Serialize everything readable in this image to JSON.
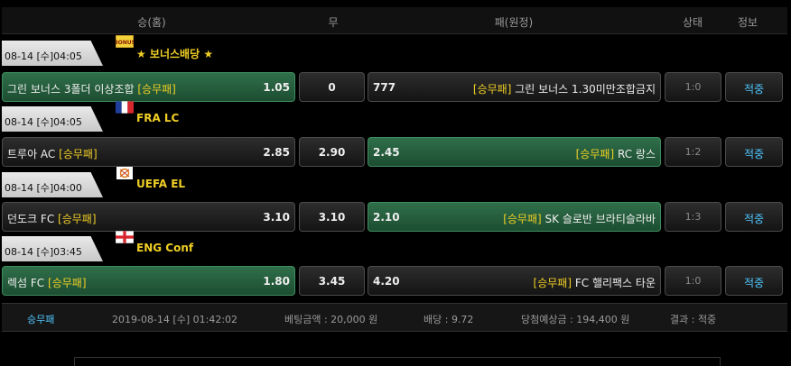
{
  "header": {
    "home": "승(홈)",
    "draw": "무",
    "away": "패(원정)",
    "status": "상태",
    "info": "정보"
  },
  "events": [
    {
      "date": "08-14 [수]04:05",
      "league": "★ 보너스배당 ★",
      "league_icon": "bonus-badge-icon",
      "home_name": "그린 보너스 3폴더 이상조합",
      "home_tag": "[승무패]",
      "home_odds": "1.05",
      "home_selected": true,
      "draw_odds": "0",
      "away_odds": "777",
      "away_tag": "[승무패]",
      "away_name": "그린 보너스 1.30미만조합금지",
      "away_selected": false,
      "status": "1:0",
      "info": "적중"
    },
    {
      "date": "08-14 [수]04:05",
      "league": "FRA LC",
      "league_icon": "france-flag-icon",
      "home_name": "트루아 AC",
      "home_tag": "[승무패]",
      "home_odds": "2.85",
      "home_selected": false,
      "draw_odds": "2.90",
      "away_odds": "2.45",
      "away_tag": "[승무패]",
      "away_name": "RC 랑스",
      "away_selected": true,
      "status": "1:2",
      "info": "적중"
    },
    {
      "date": "08-14 [수]04:00",
      "league": "UEFA EL",
      "league_icon": "uefa-el-icon",
      "home_name": "던도크 FC",
      "home_tag": "[승무패]",
      "home_odds": "3.10",
      "home_selected": false,
      "draw_odds": "3.10",
      "away_odds": "2.10",
      "away_tag": "[승무패]",
      "away_name": "SK 슬로반 브라티슬라바",
      "away_selected": true,
      "status": "1:3",
      "info": "적중"
    },
    {
      "date": "08-14 [수]03:45",
      "league": "ENG Conf",
      "league_icon": "england-flag-icon",
      "home_name": "렉섬 FC",
      "home_tag": "[승무패]",
      "home_odds": "1.80",
      "home_selected": true,
      "draw_odds": "3.45",
      "away_odds": "4.20",
      "away_tag": "[승무패]",
      "away_name": "FC 핼리팩스 타운",
      "away_selected": false,
      "status": "1:0",
      "info": "적중"
    }
  ],
  "summary": {
    "type": "승무패",
    "datetime": "2019-08-14 [수] 01:42:02",
    "bet_amount": "베팅금액 : 20,000 원",
    "odds": "배당 : 9.72",
    "expected": "당첨예상금 : 194,400 원",
    "result": "결과 : 적중"
  },
  "colors": {
    "accent_yellow": "#f0cf25",
    "win_green": "#2f6f4a",
    "link_blue": "#4fc7ff"
  }
}
